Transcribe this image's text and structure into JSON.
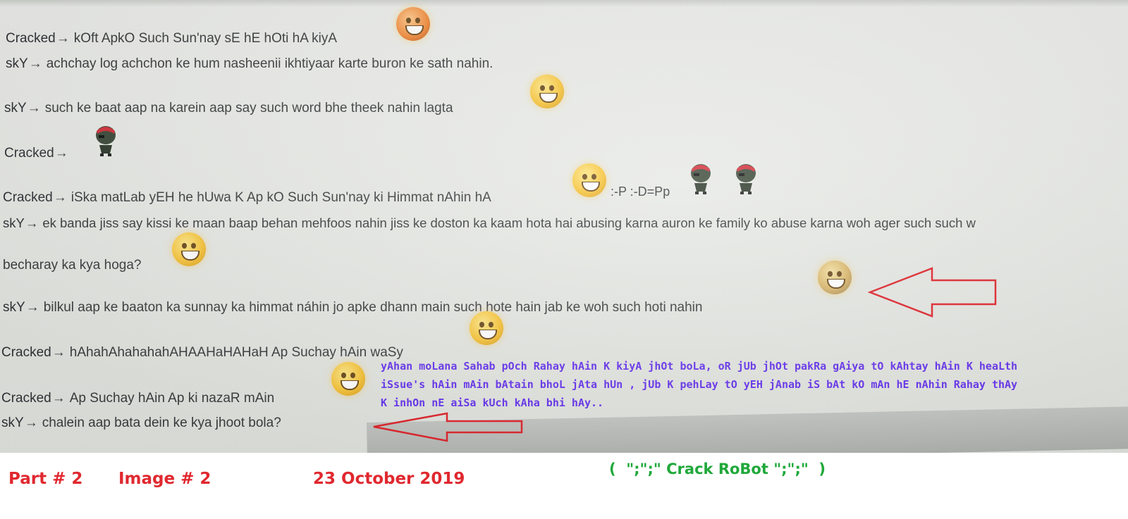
{
  "chat": {
    "arrow_glyph": "→",
    "messages": [
      {
        "sender": "Cracked",
        "text": "kOft ApkO Such Sun'nay sE hE hOti hA kiyA"
      },
      {
        "sender": "skY",
        "text": "achchay log achchon ke hum nasheenii ikhtiyaar karte buron ke sath nahin."
      },
      {
        "sender": "skY",
        "text": "such ke baat aap na karein aap say such word bhe theek nahin lagta"
      },
      {
        "sender": "Cracked",
        "text": ""
      },
      {
        "sender": "Cracked",
        "text": "iSka matLab yEH he hUwa K Ap kO Such Sun'nay ki Himmat nAhin hA",
        "extra": ":-P :-D=Pp"
      },
      {
        "sender": "skY",
        "text": "ek banda jiss say kissi ke maan baap behan mehfoos nahin jiss ke doston ka kaam hota hai abusing karna auron ke family ko abuse karna woh ager such such w"
      },
      {
        "sender": "",
        "text": "becharay ka kya hoga?"
      },
      {
        "sender": "skY",
        "text": "bilkul aap ke baaton ka sunnay ka himmat náhin jo apke dhann main such hote hain jab ke woh such hoti nahin"
      },
      {
        "sender": "Cracked",
        "text": "hAhahAhahahahAHAAHaHAHaH Ap Suchay hAin waSy"
      },
      {
        "sender": "Cracked",
        "text": "Ap Suchay hAin Ap ki nazaR mAin"
      },
      {
        "sender": "skY",
        "text": "chalein aap bata dein ke kya jhoot bola?"
      }
    ]
  },
  "annotation": {
    "lines": [
      "yAhan moLana Sahab pOch Rahay hAin K kiyA jhOt boLa, oR jUb jhOt pakRa gAiya tO kAhtay hAin K heaLth",
      "iSsue's hAin mAin bAtain bhoL jAta hUn , jUb K pehLay tO yEH jAnab iS bAt kO mAn hE nAhin Rahay thAy",
      "K inhOn nE aiSa kUch kAha bhi hAy.."
    ],
    "color": "#6633ee"
  },
  "footer": {
    "part": "Part # 2",
    "image": "Image # 2",
    "date": "23 October 2019",
    "signature": "(  \";\";\" Crack RoBot \";\";\"  )"
  },
  "colors": {
    "arrow": "#e0242c",
    "footer_red": "#e0282f",
    "footer_green": "#1fa83a",
    "emoji": "#f7c53a"
  },
  "icons": [
    "smiley-emoji",
    "pirate-emoji",
    "red-arrow"
  ]
}
